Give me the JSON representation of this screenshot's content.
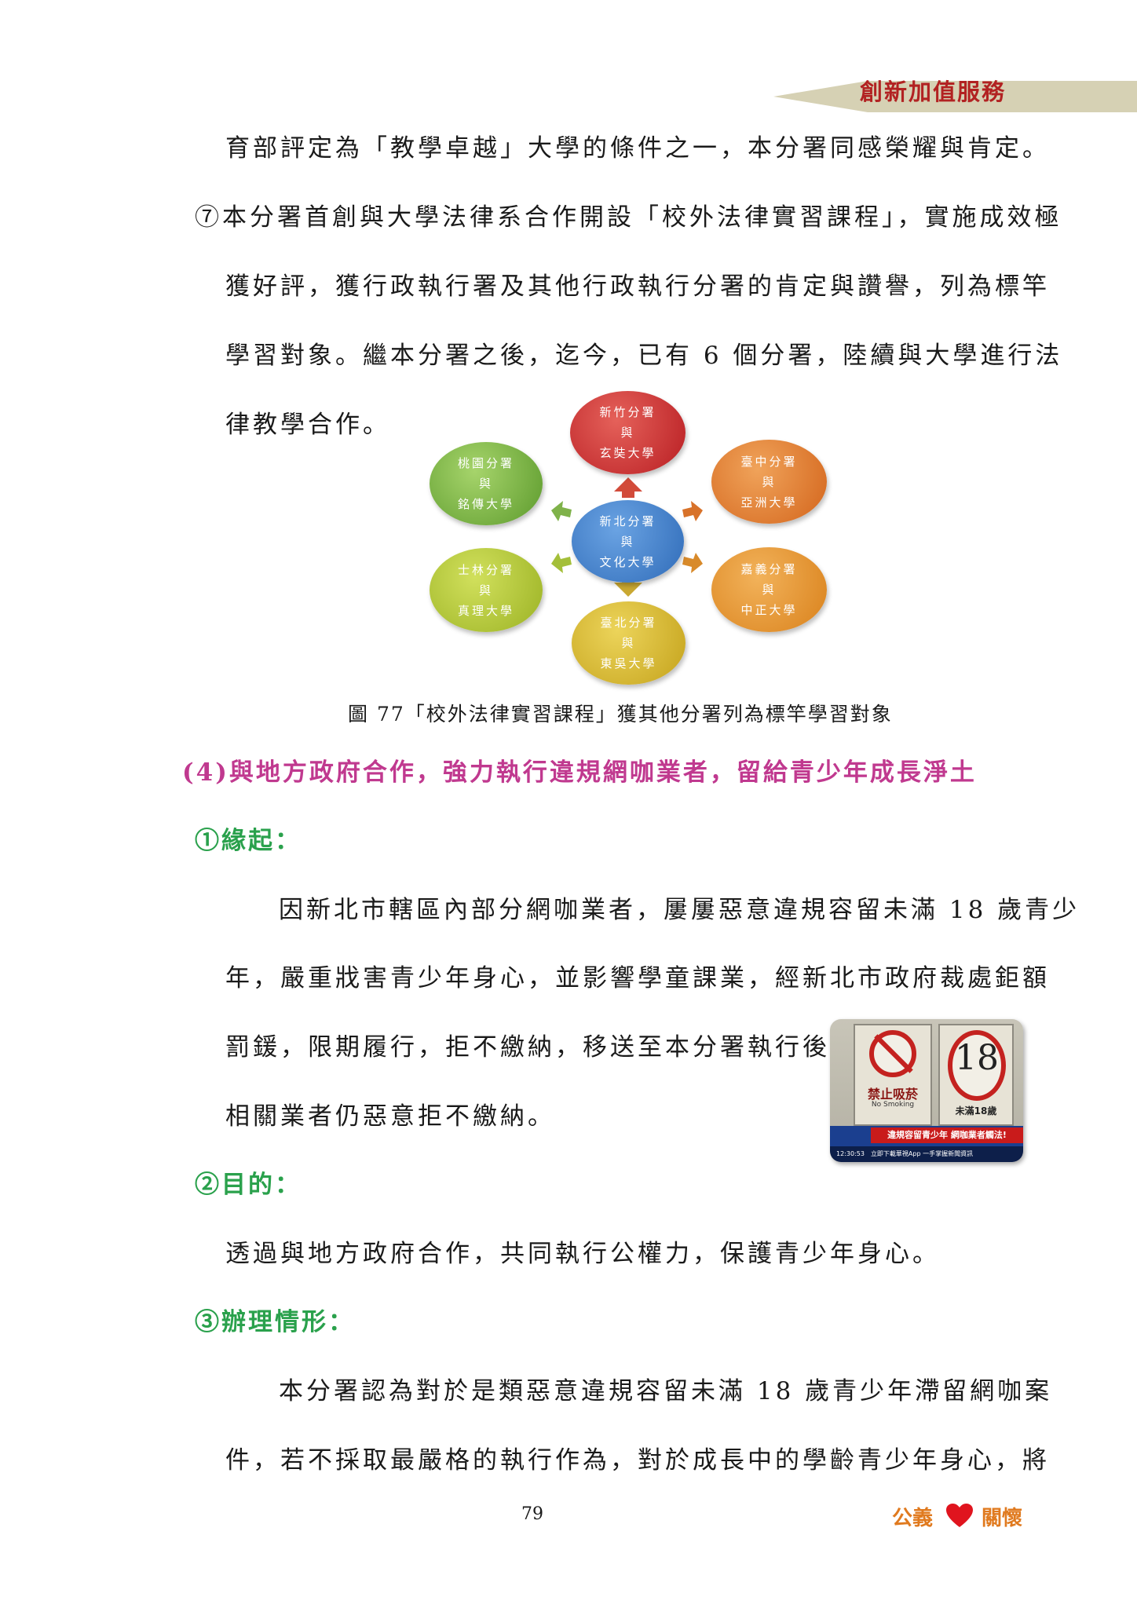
{
  "header": {
    "banner_text": "創新加值服務"
  },
  "body": {
    "p1": "育部評定為「教學卓越」大學的條件之一，本分署同感榮耀與肯定。",
    "p2_l1": "⑦本分署首創與大學法律系合作開設「校外法律實習課程」，實施成效極",
    "p2_l2": "獲好評，獲行政執行署及其他行政執行分署的肯定與讚譽，列為標竿",
    "p2_l3": "學習對象。繼本分署之後，迄今，已有 6 個分署，陸續與大學進行法",
    "p2_l4": "律教學合作。"
  },
  "diagram": {
    "center": [
      "新北分署",
      "與",
      "文化大學"
    ],
    "top": [
      "新竹分署",
      "與",
      "玄奘大學"
    ],
    "top_left": [
      "桃園分署",
      "與",
      "銘傳大學"
    ],
    "top_right": [
      "臺中分署",
      "與",
      "亞洲大學"
    ],
    "bottom_left": [
      "士林分署",
      "與",
      "真理大學"
    ],
    "bottom_right": [
      "嘉義分署",
      "與",
      "中正大學"
    ],
    "bottom": [
      "臺北分署",
      "與",
      "東吳大學"
    ]
  },
  "caption": "圖 77「校外法律實習課程」獲其他分署列為標竿學習對象",
  "section4": {
    "heading": "(4)與地方政府合作，強力執行違規網咖業者，留給青少年成長淨土",
    "origin_heading": "①緣起：",
    "origin_l1": "因新北市轄區內部分網咖業者，屢屢惡意違規容留未滿 18 歲青少",
    "origin_l2": "年，嚴重戕害青少年身心，並影響學童課業，經新北市政府裁處鉅額",
    "origin_l3": "罰鍰，限期履行，拒不繳納，移送至本分署執行後，",
    "origin_l4": "相關業者仍惡意拒不繳納。",
    "purpose_heading": "②目的：",
    "purpose_text": "透過與地方政府合作，共同執行公權力，保護青少年身心。",
    "status_heading": "③辦理情形：",
    "status_l1": "本分署認為對於是類惡意違規容留未滿 18 歲青少年滯留網咖案",
    "status_l2": "件，若不採取最嚴格的執行作為，對於成長中的學齡青少年身心，將"
  },
  "news_photo": {
    "sign_left": "禁止吸菸",
    "sign_left_en": "No Smoking",
    "sign_right_num": "18",
    "sign_right": "未滿18歲",
    "headline": "違規容留青少年 網咖業者觸法!",
    "time": "12:30:53",
    "ticker": "立即下載華視App 一手掌握新聞資訊"
  },
  "footer": {
    "page_number": "79",
    "left": "公義",
    "right": "關懷"
  },
  "colors": {
    "banner_bg": "#d6d1b4",
    "banner_text": "#b22222",
    "heading_pink": "#c0398f",
    "heading_green": "#2aa14c",
    "footer": "#e07a1f",
    "heart": "#e0141e"
  }
}
